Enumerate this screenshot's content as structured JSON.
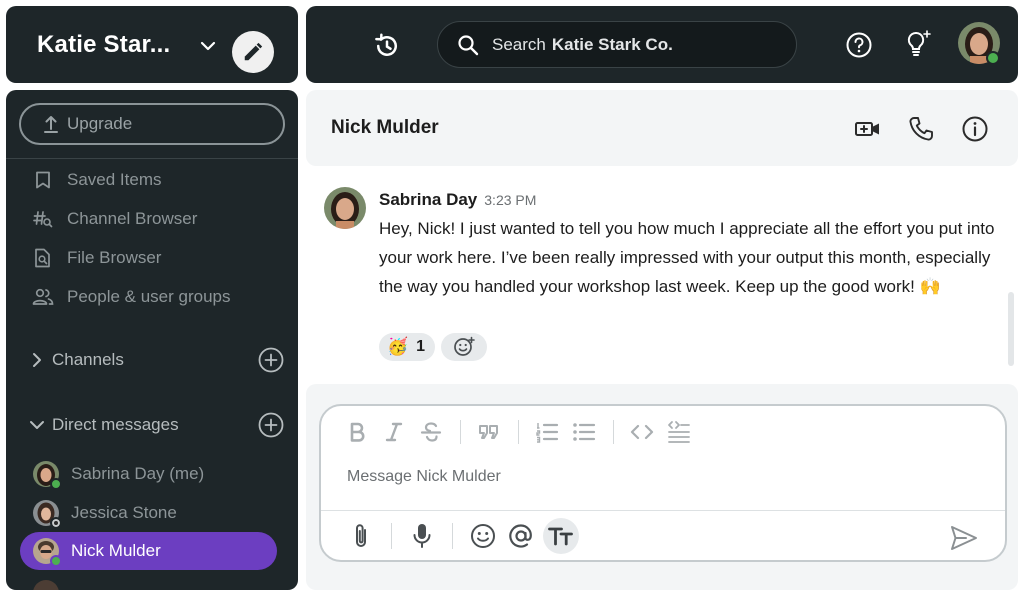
{
  "workspace": {
    "name": "Katie Star..."
  },
  "search": {
    "label": "Search",
    "scope": "Katie Stark Co."
  },
  "sidebar": {
    "upgrade_label": "Upgrade",
    "nav": [
      {
        "label": "Saved Items",
        "icon": "bookmark-icon"
      },
      {
        "label": "Channel Browser",
        "icon": "channel-search-icon"
      },
      {
        "label": "File Browser",
        "icon": "file-search-icon"
      },
      {
        "label": "People & user groups",
        "icon": "people-icon"
      }
    ],
    "channels_label": "Channels",
    "direct_messages_label": "Direct messages",
    "dms": [
      {
        "name": "Sabrina Day (me)",
        "status": "online",
        "status_color": "#4caf50"
      },
      {
        "name": "Jessica Stone",
        "status": "away",
        "status_color": "#2a2a2a"
      },
      {
        "name": "Nick Mulder",
        "status": "online",
        "status_color": "#4caf50",
        "active": true
      }
    ]
  },
  "chat": {
    "title": "Nick Mulder",
    "message": {
      "author": "Sabrina Day",
      "time": "3:23 PM",
      "text": "Hey, Nick! I just wanted to tell you how much I appreciate all the effort you put into your work here. I’ve been really impressed with your output this month, especially the way you handled your workshop last week. Keep up the good work! 🙌",
      "reactions": [
        {
          "emoji": "🥳",
          "count": "1"
        }
      ]
    }
  },
  "composer": {
    "placeholder": "Message Nick Mulder"
  },
  "colors": {
    "accent": "#6c3ec1",
    "dark_panel": "#1e2629",
    "online": "#4caf50"
  }
}
